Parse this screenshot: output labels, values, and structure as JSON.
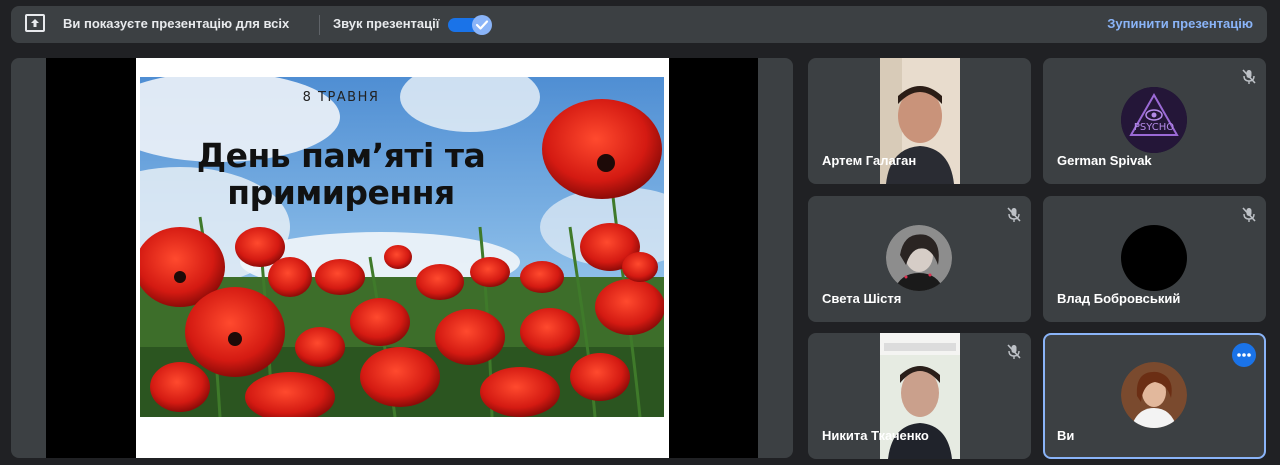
{
  "banner": {
    "presenting_text": "Ви показуєте презентацію для всіх",
    "sound_label": "Звук презентації",
    "sound_on": true,
    "stop_label": "Зупинити презентацію"
  },
  "slide": {
    "date": "8 ТРАВНЯ",
    "title_line1": "День пам’яті та",
    "title_line2": "примирення"
  },
  "participants": [
    {
      "name": "Артем Галаган",
      "muted": false
    },
    {
      "name": "German Spivak",
      "muted": true,
      "avatar_text": "PSYCHO"
    },
    {
      "name": "Света Шістя",
      "muted": true
    },
    {
      "name": "Влад Бобровський",
      "muted": true
    },
    {
      "name": "Никита Ткаченко",
      "muted": true
    },
    {
      "name": "Ви",
      "muted": false,
      "self": true
    }
  ],
  "colors": {
    "accent": "#8ab4f8",
    "toggle": "#1a73e8",
    "poppy_red": "#d41a12",
    "surface": "#3c4043",
    "background": "#202124"
  }
}
